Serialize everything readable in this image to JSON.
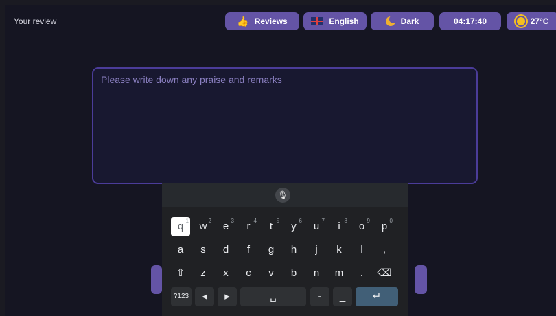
{
  "header": {
    "title": "Your review",
    "chips": [
      {
        "name": "reviews",
        "label": "Reviews",
        "icon": "thumbs-up-icon"
      },
      {
        "name": "language",
        "label": "English",
        "icon": "uk-flag-icon"
      },
      {
        "name": "theme",
        "label": "Dark",
        "icon": "moon-icon"
      },
      {
        "name": "time",
        "label": "04:17:40",
        "icon": ""
      },
      {
        "name": "weather",
        "label": "27°C",
        "icon": "sun-icon"
      }
    ]
  },
  "review": {
    "placeholder": "Please write down any praise and remarks"
  },
  "keyboard": {
    "row1": [
      {
        "key": "q",
        "hint": "1"
      },
      {
        "key": "w",
        "hint": "2"
      },
      {
        "key": "e",
        "hint": "3"
      },
      {
        "key": "r",
        "hint": "4"
      },
      {
        "key": "t",
        "hint": "5"
      },
      {
        "key": "y",
        "hint": "6"
      },
      {
        "key": "u",
        "hint": "7"
      },
      {
        "key": "i",
        "hint": "8"
      },
      {
        "key": "o",
        "hint": "9"
      },
      {
        "key": "p",
        "hint": "0"
      }
    ],
    "row2": [
      "a",
      "s",
      "d",
      "f",
      "g",
      "h",
      "j",
      "k",
      "l",
      ","
    ],
    "row3": [
      "⇧",
      "z",
      "x",
      "c",
      "v",
      "b",
      "n",
      "m",
      ".",
      "⌫"
    ],
    "row4": [
      "?123",
      "◂",
      "▸",
      "␣",
      "-",
      "_",
      "↵"
    ],
    "mic_icon": "microphone-icon"
  }
}
